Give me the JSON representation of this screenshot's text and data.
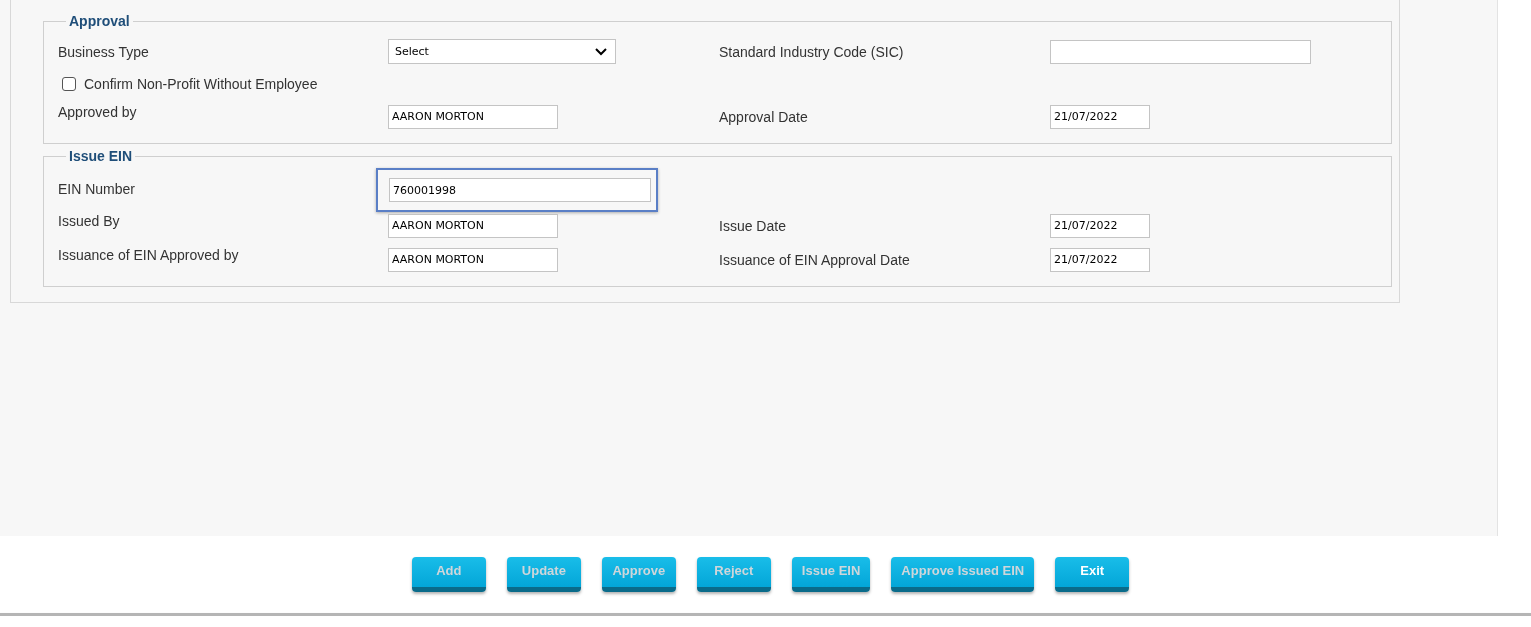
{
  "sections": [
    {
      "legend": "Approval",
      "rows": [
        {
          "kind": "pair",
          "label": "Business Type",
          "field": {
            "kind": "select",
            "value": "Select"
          },
          "label_2": "Standard Industry Code (SIC)",
          "field_2": {
            "kind": "text",
            "focused": false
          }
        },
        {
          "kind": "checkbox",
          "label": "Confirm Non-Profit Without Employee",
          "checked": false
        },
        {
          "kind": "pair",
          "label": "Approved by",
          "field": {
            "kind": "text",
            "value": "AARON MORTON",
            "focused": false
          },
          "label_2": "Approval Date",
          "field_2": {
            "kind": "text",
            "value": "21/07/2022",
            "focused": false
          }
        }
      ]
    },
    {
      "legend": "Issue EIN",
      "rows": [
        {
          "kind": "pair",
          "label": "EIN Number",
          "field": {
            "kind": "text",
            "value": "760001998",
            "focused": true
          }
        },
        {
          "kind": "pair",
          "label": "Issued By",
          "field": {
            "kind": "text",
            "value": "AARON MORTON",
            "focused": false
          },
          "label_2": "Issue Date",
          "field_2": {
            "kind": "text",
            "value": "21/07/2022",
            "focused": false
          }
        },
        {
          "kind": "pair",
          "label": "Issuance of EIN Approved by",
          "field": {
            "kind": "text",
            "value": "AARON MORTON",
            "focused": false
          },
          "label_2": "Issuance of EIN Approval Date",
          "field_2": {
            "kind": "text",
            "value": "21/07/2022",
            "focused": false
          }
        }
      ]
    }
  ],
  "buttons": [
    {
      "label": "Add",
      "disabled": true
    },
    {
      "label": "Update",
      "disabled": true
    },
    {
      "label": "Approve",
      "disabled": true
    },
    {
      "label": "Reject",
      "disabled": true
    },
    {
      "label": "Issue EIN",
      "disabled": true
    },
    {
      "label": "Approve Issued EIN",
      "disabled": true
    },
    {
      "label": "Exit",
      "disabled": false
    }
  ]
}
